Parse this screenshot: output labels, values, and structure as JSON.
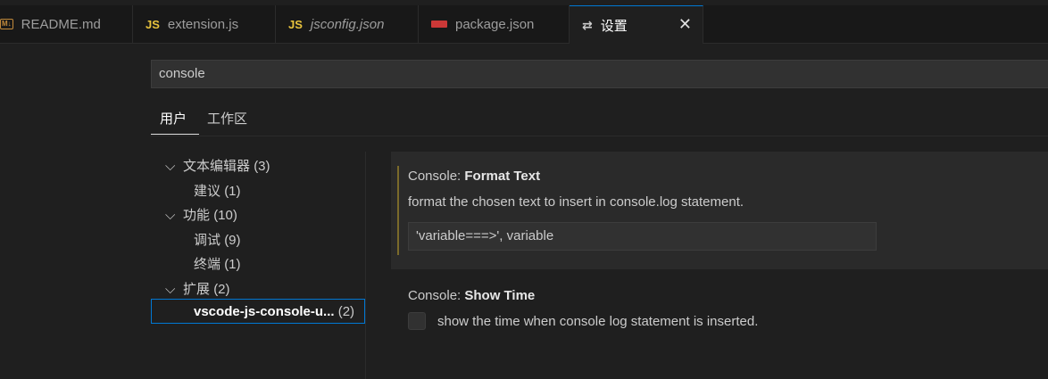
{
  "tabs": [
    {
      "label": "README.md",
      "icon": "markdown-icon",
      "icon_text": "M↓"
    },
    {
      "label": "extension.js",
      "icon": "js-icon",
      "icon_text": "JS"
    },
    {
      "label": "jsconfig.json",
      "icon": "js-icon",
      "icon_text": "JS"
    },
    {
      "label": "package.json",
      "icon": "npm-icon",
      "icon_text": ""
    },
    {
      "label": "设置",
      "icon": "settings-icon",
      "icon_text": "⇄",
      "active": true
    }
  ],
  "close_glyph": "✕",
  "search": {
    "value": "console"
  },
  "scopes": {
    "user": "用户",
    "workspace": "工作区"
  },
  "toc": [
    {
      "label": "文本编辑器",
      "count": "(3)",
      "expanded": true
    },
    {
      "label": "建议",
      "count": "(1)"
    },
    {
      "label": "功能",
      "count": "(10)",
      "expanded": true
    },
    {
      "label": "调试",
      "count": "(9)"
    },
    {
      "label": "终端",
      "count": "(1)"
    },
    {
      "label": "扩展",
      "count": "(2)",
      "expanded": true
    },
    {
      "label": "vscode-js-console-u...",
      "count": "(2)",
      "selected": true
    }
  ],
  "settings": [
    {
      "category": "Console: ",
      "name": "Format Text",
      "description": "format the chosen text to insert in console.log statement.",
      "value": "'variable===>', variable"
    },
    {
      "category": "Console: ",
      "name": "Show Time",
      "description": "show the time when console log statement is inserted.",
      "checked": false
    }
  ],
  "colors": {
    "accent": "#0078d4",
    "background": "#1f1f1f"
  }
}
